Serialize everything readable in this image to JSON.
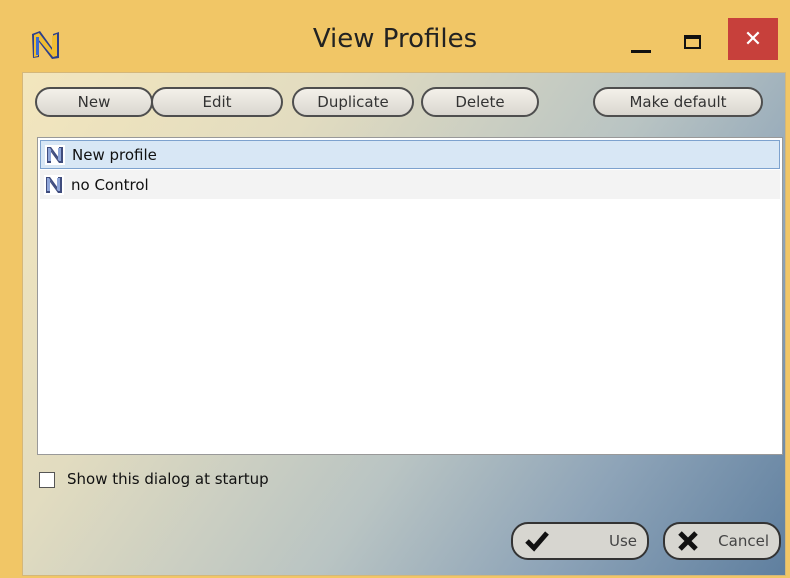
{
  "window": {
    "title": "View Profiles",
    "close_glyph": "✕"
  },
  "toolbar": {
    "new_label": "New",
    "edit_label": "Edit",
    "duplicate_label": "Duplicate",
    "delete_label": "Delete",
    "make_default_label": "Make default"
  },
  "profiles": [
    {
      "label": "New profile",
      "selected": true
    },
    {
      "label": "no Control",
      "selected": false
    }
  ],
  "options": {
    "show_at_startup_label": "Show this dialog at startup",
    "show_at_startup_checked": false
  },
  "footer": {
    "use_label": "Use",
    "cancel_label": "Cancel"
  },
  "colors": {
    "titlebar": "#f1c666",
    "close_button": "#c7403b",
    "selection": "#d8e7f5"
  },
  "icons": [
    "app-logo-icon",
    "minimize-icon",
    "maximize-icon",
    "close-icon",
    "profile-icon",
    "checkmark-icon",
    "x-icon"
  ]
}
